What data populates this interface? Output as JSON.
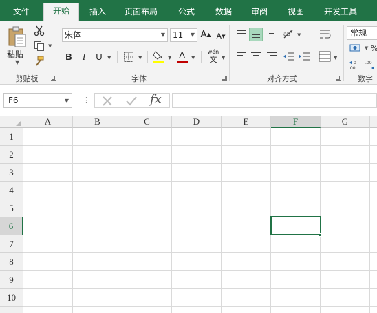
{
  "tabs": [
    {
      "label": "文件",
      "active": false
    },
    {
      "label": "开始",
      "active": true
    },
    {
      "label": "插入",
      "active": false
    },
    {
      "label": "页面布局",
      "active": false
    },
    {
      "label": "公式",
      "active": false
    },
    {
      "label": "数据",
      "active": false
    },
    {
      "label": "审阅",
      "active": false
    },
    {
      "label": "视图",
      "active": false
    },
    {
      "label": "开发工具",
      "active": false
    }
  ],
  "ribbon": {
    "clipboard": {
      "paste_label": "粘贴",
      "group_label": "剪贴板"
    },
    "font": {
      "font_name": "宋体",
      "font_size": "11",
      "bold": "B",
      "italic": "I",
      "underline": "U",
      "font_color_glyph": "A",
      "phonetic_top": "wén",
      "phonetic_bottom": "文",
      "grow_font": "A",
      "shrink_font": "A",
      "group_label": "字体"
    },
    "alignment": {
      "group_label": "对齐方式"
    },
    "number": {
      "format": "常规",
      "group_label": "数字"
    }
  },
  "formula_bar": {
    "name_box": "F6",
    "fx": "fx",
    "value": ""
  },
  "sheet": {
    "columns": [
      "A",
      "B",
      "C",
      "D",
      "E",
      "F",
      "G"
    ],
    "rows": [
      "1",
      "2",
      "3",
      "4",
      "5",
      "6",
      "7",
      "8",
      "9",
      "10"
    ],
    "selected_column": "F",
    "selected_row": "6",
    "active_cell": "F6"
  },
  "colors": {
    "accent": "#217346",
    "ribbon_bg": "#f3f3f3",
    "header_bg": "#f0f0f0",
    "highlight_fill": "#ffff00",
    "font_color": "#c00000"
  }
}
